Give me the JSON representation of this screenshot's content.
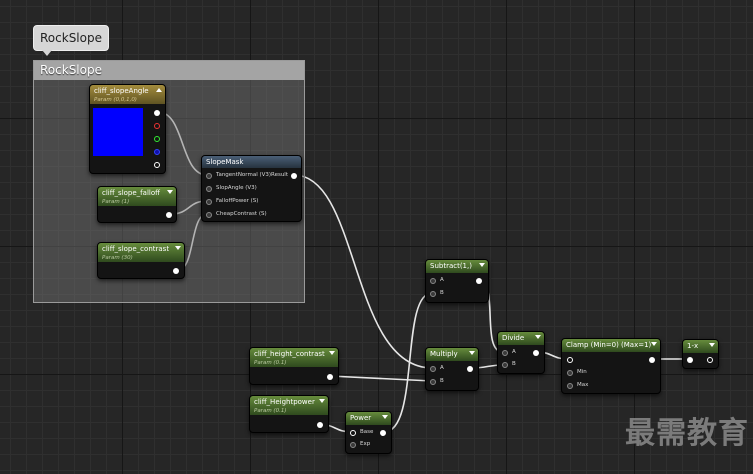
{
  "comment": {
    "bubble": "RockSlope",
    "title": "RockSlope"
  },
  "nodes": {
    "slope_angle": {
      "title": "cliff_slopeAngle",
      "subtitle": "Param (0,0,1,0)"
    },
    "slope_falloff": {
      "title": "cliff_slope_falloff",
      "subtitle": "Param (1)"
    },
    "slope_contrast": {
      "title": "cliff_slope_contrast",
      "subtitle": "Param (30)"
    },
    "slope_mask": {
      "title": "SlopeMask",
      "pins": [
        "TangentNormal (V3)",
        "SlopAngle (V3)",
        "FalloffPower (S)",
        "CheapContrast (S)"
      ],
      "output": "Result"
    },
    "subtract": {
      "title": "Subtract(1,)",
      "pins": [
        "A",
        "B"
      ]
    },
    "multiply": {
      "title": "Multiply",
      "pins": [
        "A",
        "B"
      ]
    },
    "divide": {
      "title": "Divide",
      "pins": [
        "A",
        "B"
      ]
    },
    "clamp": {
      "title": "Clamp (Min=0) (Max=1)",
      "pins": [
        "",
        "Min",
        "Max"
      ]
    },
    "one_minus": {
      "title": "1-x"
    },
    "height_contrast": {
      "title": "cliff_height_contrast",
      "subtitle": "Param (0.1)"
    },
    "height_power": {
      "title": "cliff_Heightpower",
      "subtitle": "Param (0.1)"
    },
    "power": {
      "title": "Power",
      "pins": [
        "Base",
        "Exp"
      ]
    }
  },
  "colors": {
    "swatch": "#0000ff",
    "wire": "#e6e6e6"
  },
  "watermark": "最需教育"
}
